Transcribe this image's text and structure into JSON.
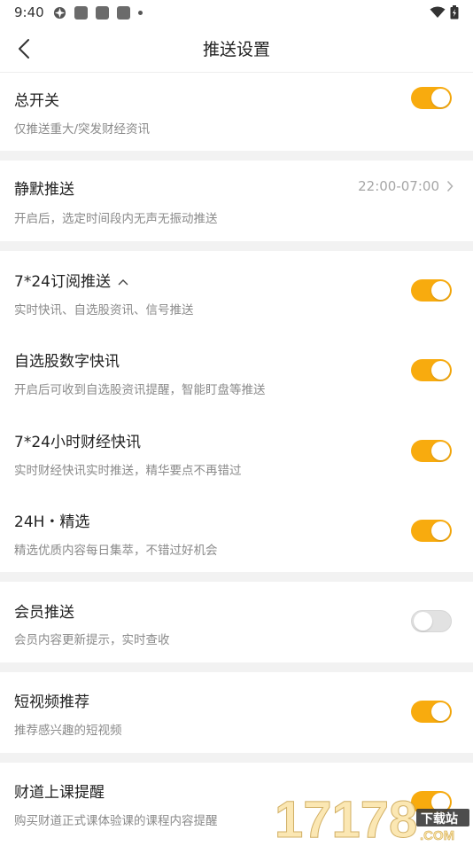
{
  "status_bar": {
    "time": "9:40"
  },
  "nav": {
    "title": "推送设置"
  },
  "master": {
    "label": "总开关",
    "desc": "仅推送重大/突发财经资讯",
    "on": true
  },
  "quiet": {
    "label": "静默推送",
    "desc": "开启后，选定时间段内无声无振动推送",
    "time_range": "22:00-07:00"
  },
  "subscriptions": [
    {
      "label": "7*24订阅推送",
      "desc": "实时快讯、自选股资讯、信号推送",
      "on": true
    },
    {
      "label": "自选股数字快讯",
      "desc": "开启后可收到自选股资讯提醒，智能盯盘等推送",
      "on": true
    },
    {
      "label": "7*24小时财经快讯",
      "desc": "实时财经快讯实时推送，精华要点不再错过",
      "on": true
    },
    {
      "label": "24H・精选",
      "desc": "精选优质内容每日集萃，不错过好机会",
      "on": true
    }
  ],
  "member": {
    "label": "会员推送",
    "desc": "会员内容更新提示，实时查收",
    "on": false
  },
  "video": {
    "label": "短视频推荐",
    "desc": "推荐感兴趣的短视频",
    "on": true
  },
  "course": {
    "label": "财道上课提醒",
    "desc": "购买财道正式课体验课的课程内容提醒",
    "on": true
  },
  "watermark": {
    "line1": "下载站",
    "line2": "17178",
    "line3": ".COM"
  },
  "colors": {
    "accent": "#f8ab0e",
    "separator": "#f2f2f2"
  }
}
